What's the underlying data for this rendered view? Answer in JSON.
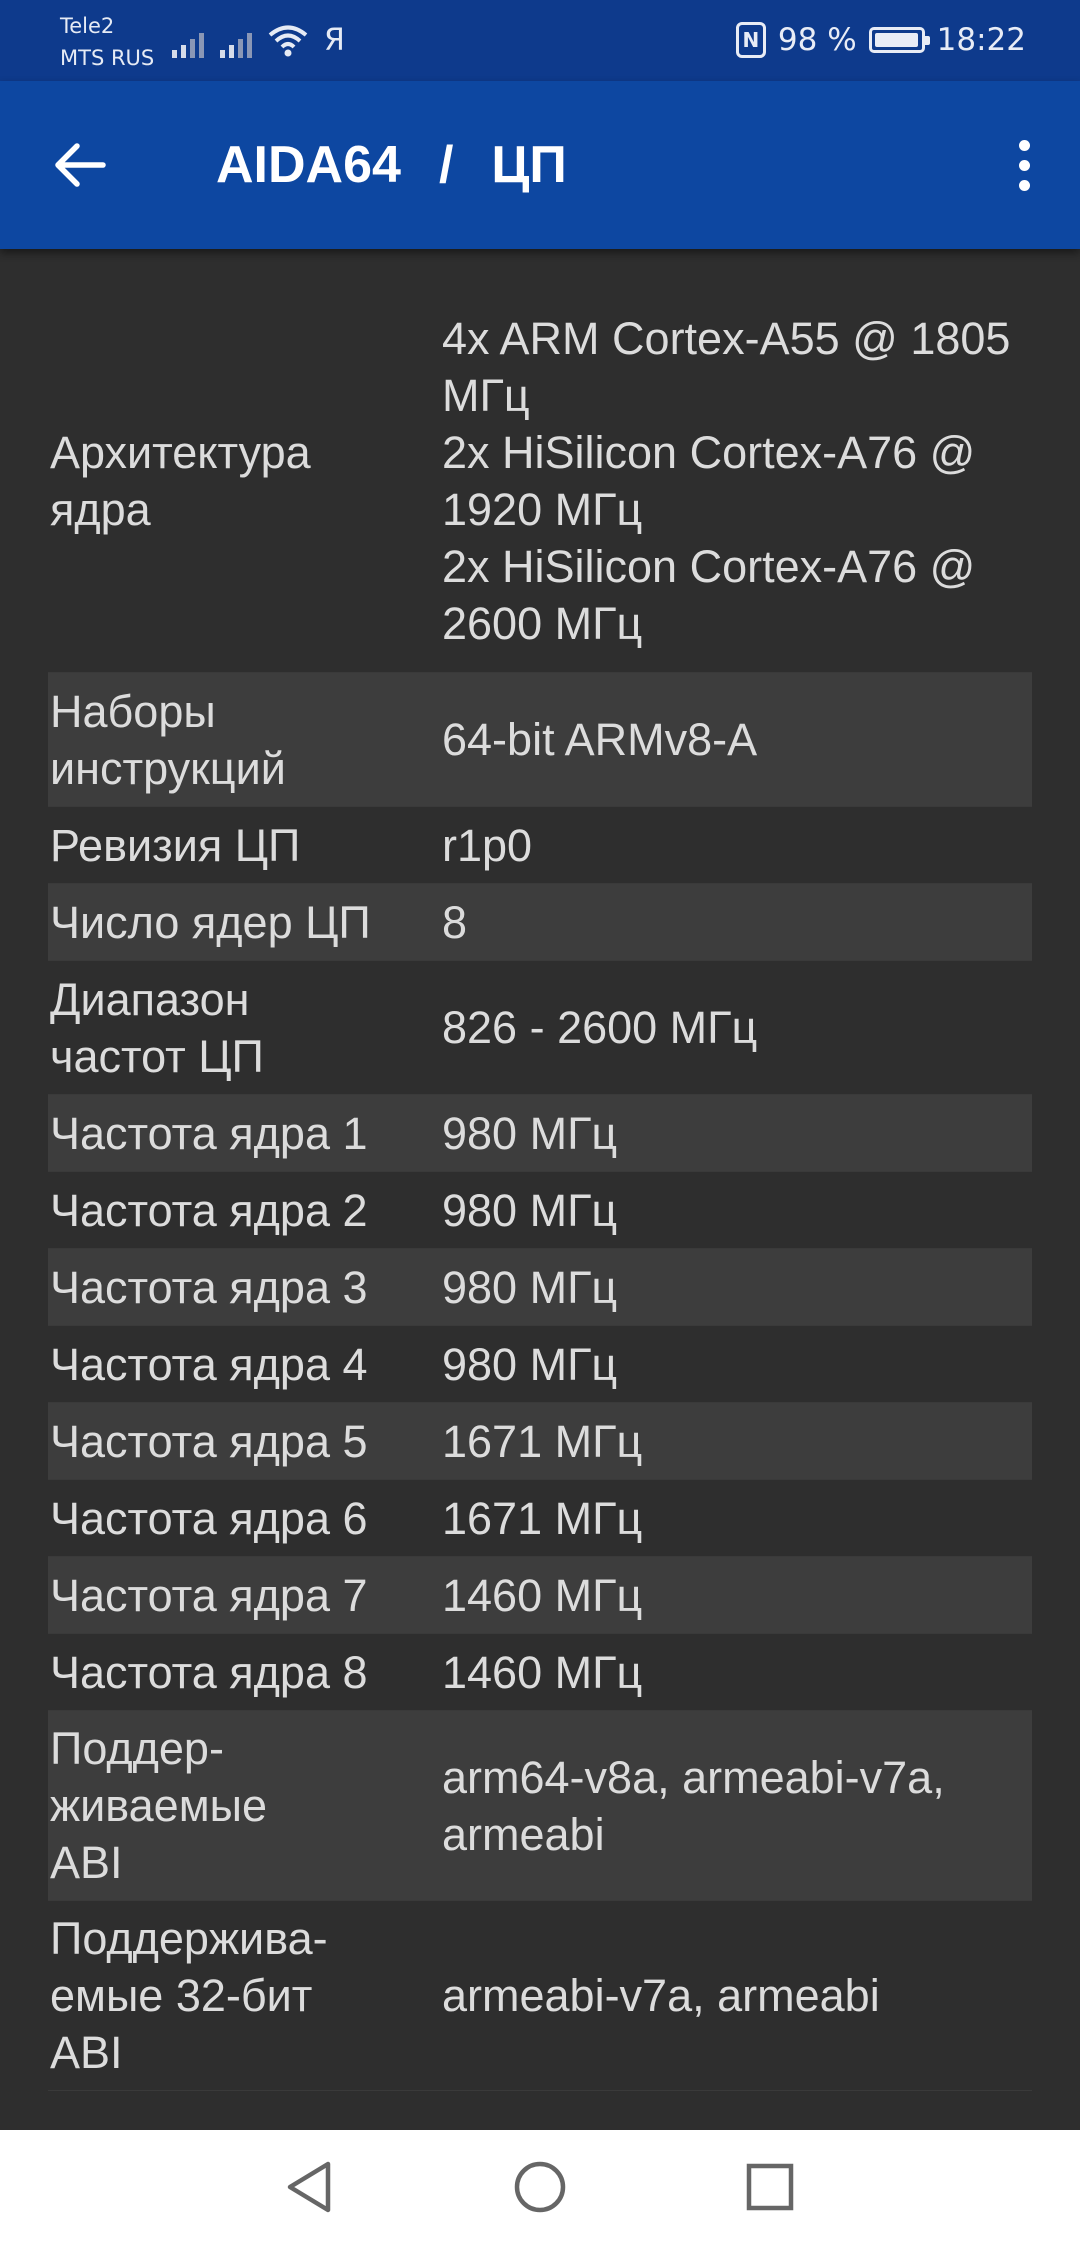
{
  "status_bar": {
    "carrier_1": "Tele2",
    "carrier_2": "MTS RUS",
    "ya_glyph": "Я",
    "nfc_glyph": "N",
    "battery_text": "98 %",
    "battery_level": 0.98,
    "time": "18:22"
  },
  "app_bar": {
    "app_name": "AIDA64",
    "separator": "/",
    "section": "ЦП",
    "back_icon": "arrow-left-icon",
    "menu_icon": "more-vertical-icon",
    "color": "#0d47a1"
  },
  "rows": [
    {
      "label": "Архитектура\nядра",
      "value": "4x ARM Cortex-A55 @ 1805\nМГц\n2x HiSilicon Cortex-A76 @\n1920 МГц\n2x HiSilicon Cortex-A76 @\n2600 МГц"
    },
    {
      "label": "Наборы\nинструкций",
      "value": "64-bit ARMv8-A"
    },
    {
      "label": "Ревизия ЦП",
      "value": "r1p0"
    },
    {
      "label": "Число ядер ЦП",
      "value": "8"
    },
    {
      "label": "Диапазон\nчастот ЦП",
      "value": "826 - 2600 МГц"
    },
    {
      "label": "Частота ядра 1",
      "value": "980 МГц"
    },
    {
      "label": "Частота ядра 2",
      "value": "980 МГц"
    },
    {
      "label": "Частота ядра 3",
      "value": "980 МГц"
    },
    {
      "label": "Частота ядра 4",
      "value": "980 МГц"
    },
    {
      "label": "Частота ядра 5",
      "value": "1671 МГц"
    },
    {
      "label": "Частота ядра 6",
      "value": "1671 МГц"
    },
    {
      "label": "Частота ядра 7",
      "value": "1460 МГц"
    },
    {
      "label": "Частота ядра 8",
      "value": "1460 МГц"
    },
    {
      "label": "Поддер-\nживаемые\nABI",
      "value": "arm64-v8a, armeabi-v7a,\narmeabi"
    },
    {
      "label": "Поддержива-\nемые 32-бит\nABI",
      "value": "armeabi-v7a, armeabi"
    }
  ],
  "nav_bar": {
    "back_icon": "triangle-back-icon",
    "home_icon": "circle-home-icon",
    "recents_icon": "square-recents-icon"
  }
}
